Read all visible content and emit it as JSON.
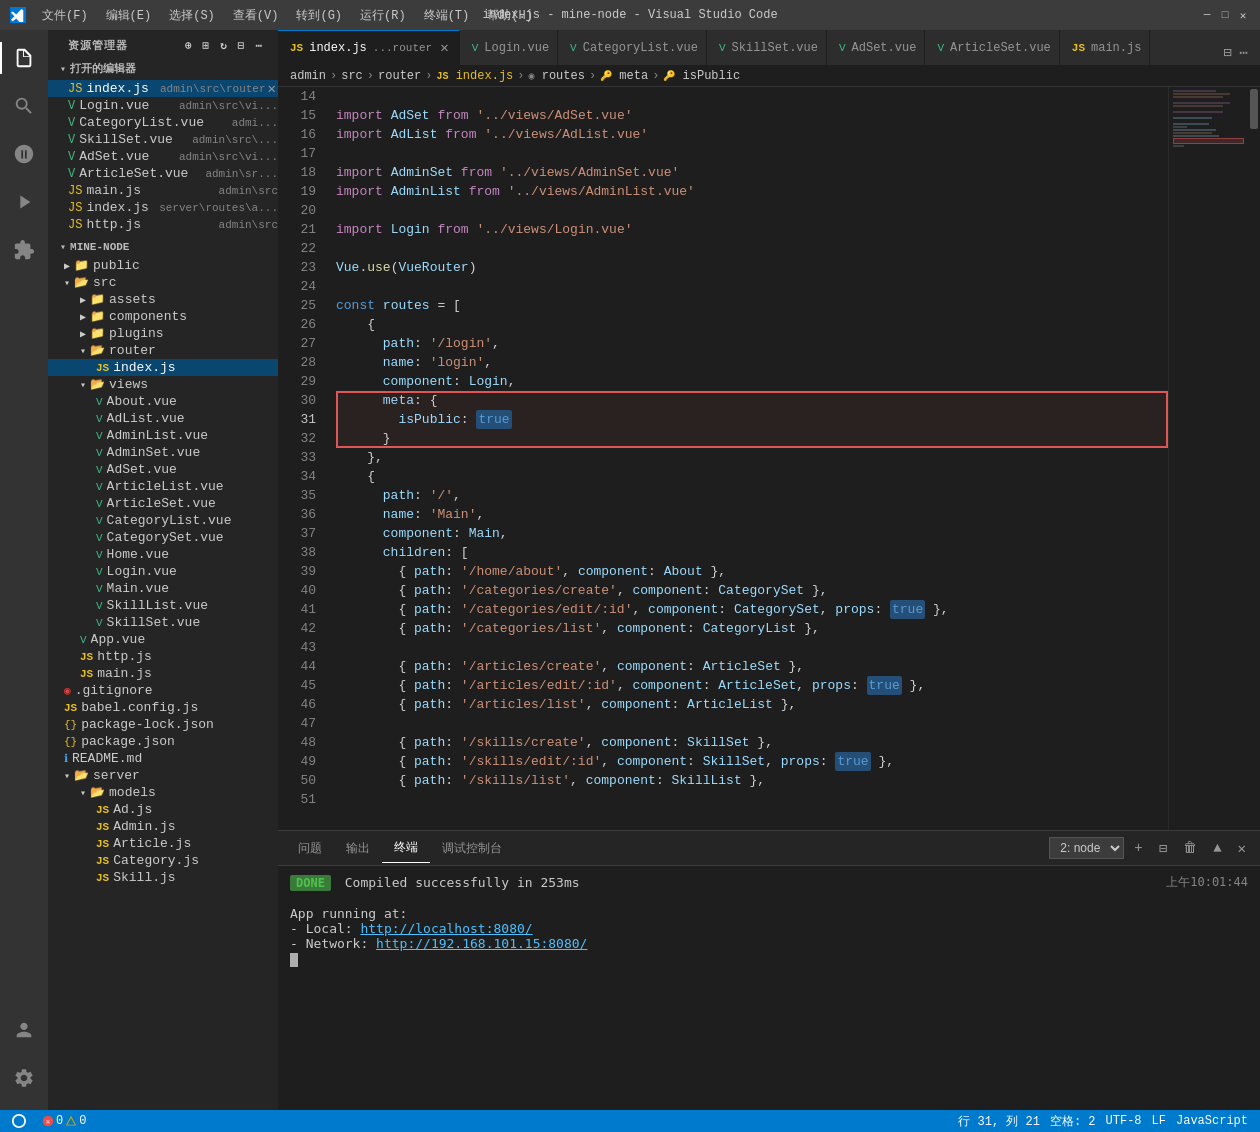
{
  "titleBar": {
    "menus": [
      "文件(F)",
      "编辑(E)",
      "选择(S)",
      "查看(V)",
      "转到(G)",
      "运行(R)",
      "终端(T)",
      "帮助(H)"
    ],
    "title": "index.js - mine-node - Visual Studio Code",
    "controls": [
      "─",
      "□",
      "✕"
    ]
  },
  "activityBar": {
    "icons": [
      {
        "name": "files-icon",
        "symbol": "⎘",
        "active": true
      },
      {
        "name": "search-icon",
        "symbol": "🔍",
        "active": false
      },
      {
        "name": "source-control-icon",
        "symbol": "⑂",
        "active": false
      },
      {
        "name": "debug-icon",
        "symbol": "▷",
        "active": false
      },
      {
        "name": "extensions-icon",
        "symbol": "⊞",
        "active": false
      }
    ],
    "bottomIcons": [
      {
        "name": "account-icon",
        "symbol": "👤"
      },
      {
        "name": "settings-icon",
        "symbol": "⚙"
      }
    ]
  },
  "sidebar": {
    "header": "资源管理器",
    "openEditors": {
      "title": "打开的编辑器",
      "items": [
        {
          "name": "index.js",
          "path": "admin\\src\\router",
          "type": "js",
          "active": true,
          "hasClose": true
        },
        {
          "name": "Login.vue",
          "path": "admin\\src\\vi...",
          "type": "vue"
        },
        {
          "name": "CategoryList.vue",
          "path": "admi...",
          "type": "vue"
        },
        {
          "name": "SkillSet.vue",
          "path": "admin\\src\\...",
          "type": "vue"
        },
        {
          "name": "AdSet.vue",
          "path": "admin\\src\\vi...",
          "type": "vue"
        },
        {
          "name": "ArticleSet.vue",
          "path": "admin\\sr...",
          "type": "vue"
        },
        {
          "name": "main.js",
          "path": "admin\\src",
          "type": "js"
        },
        {
          "name": "index.js",
          "path": "server\\routes\\a...",
          "type": "js"
        },
        {
          "name": "http.js",
          "path": "admin\\src",
          "type": "js"
        }
      ]
    },
    "mineNode": {
      "title": "MINE-NODE",
      "items": [
        {
          "name": "public",
          "type": "folder",
          "level": 1,
          "collapsed": true
        },
        {
          "name": "src",
          "type": "folder",
          "level": 1,
          "expanded": true
        },
        {
          "name": "assets",
          "type": "folder",
          "level": 2,
          "collapsed": true
        },
        {
          "name": "components",
          "type": "folder",
          "level": 2,
          "collapsed": true
        },
        {
          "name": "plugins",
          "type": "folder",
          "level": 2,
          "collapsed": true
        },
        {
          "name": "router",
          "type": "folder",
          "level": 2,
          "expanded": true
        },
        {
          "name": "index.js",
          "type": "js",
          "level": 3,
          "active": true
        },
        {
          "name": "views",
          "type": "folder",
          "level": 2,
          "expanded": true
        },
        {
          "name": "About.vue",
          "type": "vue",
          "level": 3
        },
        {
          "name": "AdList.vue",
          "type": "vue",
          "level": 3
        },
        {
          "name": "AdminList.vue",
          "type": "vue",
          "level": 3
        },
        {
          "name": "AdminSet.vue",
          "type": "vue",
          "level": 3
        },
        {
          "name": "AdSet.vue",
          "type": "vue",
          "level": 3
        },
        {
          "name": "ArticleList.vue",
          "type": "vue",
          "level": 3
        },
        {
          "name": "ArticleSet.vue",
          "type": "vue",
          "level": 3
        },
        {
          "name": "CategoryList.vue",
          "type": "vue",
          "level": 3
        },
        {
          "name": "CategorySet.vue",
          "type": "vue",
          "level": 3
        },
        {
          "name": "Home.vue",
          "type": "vue",
          "level": 3
        },
        {
          "name": "Login.vue",
          "type": "vue",
          "level": 3
        },
        {
          "name": "Main.vue",
          "type": "vue",
          "level": 3
        },
        {
          "name": "SkillList.vue",
          "type": "vue",
          "level": 3
        },
        {
          "name": "SkillSet.vue",
          "type": "vue",
          "level": 3
        },
        {
          "name": "App.vue",
          "type": "vue",
          "level": 2
        },
        {
          "name": "http.js",
          "type": "js",
          "level": 2
        },
        {
          "name": "main.js",
          "type": "js",
          "level": 2
        },
        {
          "name": ".gitignore",
          "type": "git",
          "level": 1
        },
        {
          "name": "babel.config.js",
          "type": "js",
          "level": 1
        },
        {
          "name": "package-lock.json",
          "type": "json",
          "level": 1
        },
        {
          "name": "package.json",
          "type": "json",
          "level": 1
        },
        {
          "name": "README.md",
          "type": "md",
          "level": 1
        },
        {
          "name": "server",
          "type": "folder",
          "level": 1,
          "expanded": true
        },
        {
          "name": "models",
          "type": "folder",
          "level": 2,
          "expanded": true
        },
        {
          "name": "Ad.js",
          "type": "js",
          "level": 3
        },
        {
          "name": "Admin.js",
          "type": "js",
          "level": 3
        },
        {
          "name": "Article.js",
          "type": "js",
          "level": 3
        },
        {
          "name": "Category.js",
          "type": "js",
          "level": 3
        },
        {
          "name": "Skill.js",
          "type": "js",
          "level": 3
        }
      ]
    }
  },
  "tabs": [
    {
      "name": "index.js",
      "path": "...\\router",
      "type": "js",
      "active": true,
      "modified": false
    },
    {
      "name": "Login.vue",
      "type": "vue",
      "active": false
    },
    {
      "name": "CategoryList.vue",
      "type": "vue",
      "active": false
    },
    {
      "name": "SkillSet.vue",
      "type": "vue",
      "active": false
    },
    {
      "name": "AdSet.vue",
      "type": "vue",
      "active": false
    },
    {
      "name": "ArticleSet.vue",
      "type": "vue",
      "active": false
    },
    {
      "name": "main.js",
      "type": "js",
      "active": false
    }
  ],
  "breadcrumb": {
    "items": [
      "admin",
      "src",
      "router",
      "index.js",
      "routes",
      "meta",
      "isPublic"
    ]
  },
  "codeLines": [
    {
      "num": 14,
      "content": ""
    },
    {
      "num": 15,
      "content": "  import AdSet from '../views/AdSet.vue'"
    },
    {
      "num": 16,
      "content": "  import AdList from '../views/AdList.vue'"
    },
    {
      "num": 17,
      "content": ""
    },
    {
      "num": 18,
      "content": "  import AdminSet from '../views/AdminSet.vue'"
    },
    {
      "num": 19,
      "content": "  import AdminList from '../views/AdminList.vue'"
    },
    {
      "num": 20,
      "content": ""
    },
    {
      "num": 21,
      "content": "  import Login from '../views/Login.vue'"
    },
    {
      "num": 22,
      "content": ""
    },
    {
      "num": 23,
      "content": "  Vue.use(VueRouter)"
    },
    {
      "num": 24,
      "content": ""
    },
    {
      "num": 25,
      "content": "  const routes = ["
    },
    {
      "num": 26,
      "content": "    {"
    },
    {
      "num": 27,
      "content": "      path: '/login',"
    },
    {
      "num": 28,
      "content": "      name: 'login',"
    },
    {
      "num": 29,
      "content": "      component: Login,"
    },
    {
      "num": 30,
      "content": "      meta: {",
      "highlighted": true
    },
    {
      "num": 31,
      "content": "        isPublic: true",
      "highlighted": true,
      "current": true
    },
    {
      "num": 32,
      "content": "      }",
      "highlighted": true
    },
    {
      "num": 33,
      "content": "    },"
    },
    {
      "num": 34,
      "content": "    {"
    },
    {
      "num": 35,
      "content": "      path: '/',"
    },
    {
      "num": 36,
      "content": "      name: 'Main',"
    },
    {
      "num": 37,
      "content": "      component: Main,"
    },
    {
      "num": 38,
      "content": "      children: ["
    },
    {
      "num": 39,
      "content": "        { path: '/home/about', component: About },"
    },
    {
      "num": 40,
      "content": "        { path: '/categories/create', component: CategorySet },"
    },
    {
      "num": 41,
      "content": "        { path: '/categories/edit/:id', component: CategorySet, props: true },"
    },
    {
      "num": 42,
      "content": "        { path: '/categories/list', component: CategoryList },"
    },
    {
      "num": 43,
      "content": ""
    },
    {
      "num": 44,
      "content": "        { path: '/articles/create', component: ArticleSet },"
    },
    {
      "num": 45,
      "content": "        { path: '/articles/edit/:id', component: ArticleSet, props: true },"
    },
    {
      "num": 46,
      "content": "        { path: '/articles/list', component: ArticleList },"
    },
    {
      "num": 47,
      "content": ""
    },
    {
      "num": 48,
      "content": "        { path: '/skills/create', component: SkillSet },"
    },
    {
      "num": 49,
      "content": "        { path: '/skills/edit/:id', component: SkillSet, props: true },"
    },
    {
      "num": 50,
      "content": "        { path: '/skills/list', component: SkillList },"
    },
    {
      "num": 51,
      "content": ""
    }
  ],
  "terminal": {
    "tabs": [
      "问题",
      "输出",
      "终端",
      "调试控制台"
    ],
    "activeTab": "终端",
    "selector": "2: node",
    "output": [
      {
        "type": "done",
        "text": "Compiled successfully in 253ms",
        "badge": "DONE"
      },
      {
        "type": "blank"
      },
      {
        "type": "text",
        "text": "App running at:"
      },
      {
        "type": "link-line",
        "label": "  - Local:   ",
        "url": "http://localhost:8080/"
      },
      {
        "type": "link-line",
        "label": "  - Network: ",
        "url": "http://192.168.101.15:8080/"
      },
      {
        "type": "cursor"
      }
    ],
    "timestamp": "上午10:01:44"
  },
  "statusBar": {
    "left": [
      {
        "text": "⚐ 0 △ 0",
        "name": "errors-warnings"
      },
      {
        "text": "⚠ 0 △ 0",
        "name": "problems-count"
      }
    ],
    "right": [
      {
        "text": "行 31, 列 21",
        "name": "cursor-position"
      },
      {
        "text": "空格: 2",
        "name": "indentation"
      },
      {
        "text": "UTF-8",
        "name": "encoding"
      },
      {
        "text": "LF",
        "name": "line-ending"
      },
      {
        "text": "JavaScript",
        "name": "language-mode"
      }
    ]
  }
}
